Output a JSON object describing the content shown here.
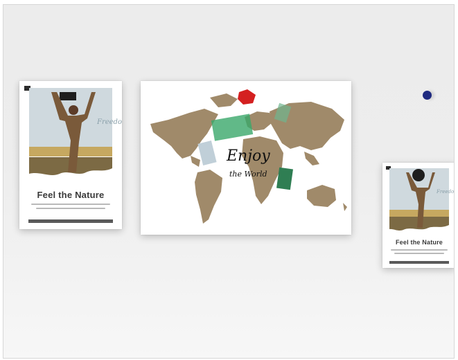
{
  "posters": {
    "large": {
      "title": "Feel the Nature"
    },
    "small": {
      "title": "Feel the Nature"
    }
  },
  "map_print": {
    "title_line1": "Enjoy",
    "title_line2": "the World"
  },
  "colors": {
    "map_land": "#a08a6a",
    "grass": "#b89a58",
    "sky": "#c9d6dc",
    "accent_dot": "#1f2a80",
    "red_sticker": "#d42020",
    "green_sticker": "#3aa86a"
  },
  "icons": [
    "navigation-dot-icon"
  ]
}
